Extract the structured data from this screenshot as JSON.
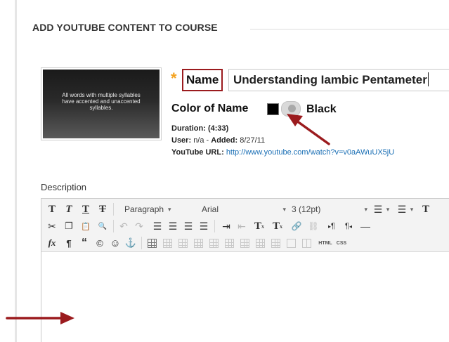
{
  "page": {
    "title": "ADD YOUTUBE CONTENT TO COURSE"
  },
  "video": {
    "thumbnail_text": "All words with multiple syllables have accented and unaccented syllables."
  },
  "form": {
    "required_marker": "*",
    "name_label": "Name",
    "name_value": "Understanding Iambic Pentameter",
    "color_label": "Color of Name",
    "color_value": "Black",
    "color_swatch": "#000000"
  },
  "meta": {
    "duration_label": "Duration:",
    "duration_value": "(4:33)",
    "user_label": "User:",
    "user_value": "n/a",
    "added_label": "Added:",
    "added_value": "8/27/11",
    "url_label": "YouTube URL:",
    "url_value": "http://www.youtube.com/watch?v=v0aAWuUX5jU"
  },
  "editor": {
    "description_label": "Description",
    "paragraph": "Paragraph",
    "font": "Arial",
    "size": "3 (12pt)",
    "html_label": "HTML",
    "css_label": "CSS"
  },
  "icons": {
    "bold": "T",
    "italic": "T",
    "underline": "T",
    "strikethrough": "T",
    "bullets": "☰",
    "numbering": "☰",
    "text-color": "T",
    "cut": "✂",
    "copy": "❐",
    "paste": "📋",
    "search": "🔍",
    "undo": "↶",
    "redo": "↷",
    "align-left": "☰",
    "align-center": "☰",
    "align-right": "☰",
    "justify": "☰",
    "indent": "⇥",
    "outdent": "⇤",
    "superscript": "T",
    "subscript": "T",
    "link": "🔗",
    "unlink": "⛓",
    "ltr": "¶",
    "rtl": "¶",
    "hr": "—",
    "formula": "fx",
    "pilcrow": "¶",
    "quote": "“",
    "copyright": "©",
    "emoji": "☺",
    "anchor": "⚓"
  },
  "colors": {
    "accent_red": "#9b1b1e",
    "required_star": "#f4a21e",
    "link": "#1a6fb5"
  }
}
